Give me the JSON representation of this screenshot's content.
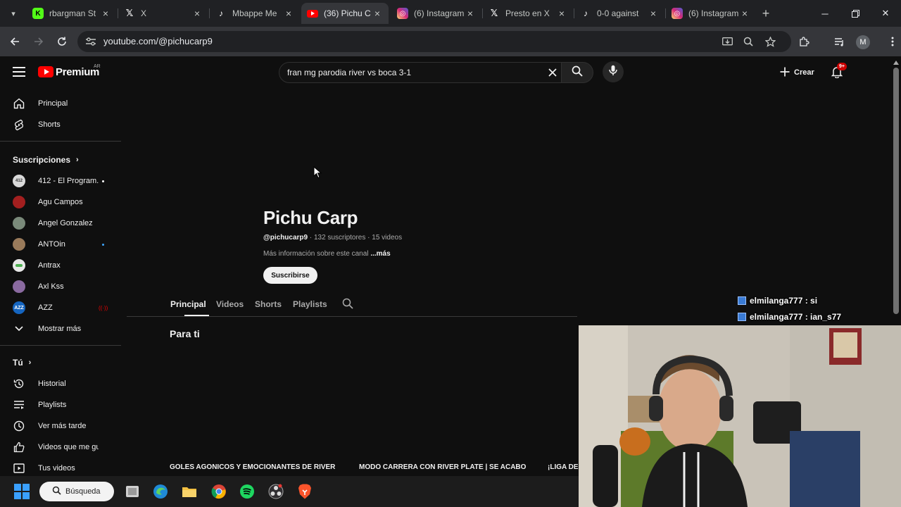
{
  "browser": {
    "tabs": [
      {
        "title": "rbargman St",
        "favicon": "kick-logo",
        "color": "#53fc18",
        "active": false
      },
      {
        "title": "X",
        "favicon": "x-logo",
        "color": "#000000",
        "active": false
      },
      {
        "title": "Mbappe Me",
        "favicon": "tiktok-logo",
        "color": "#000000",
        "active": false
      },
      {
        "title": "(36) Pichu C",
        "favicon": "youtube-logo",
        "color": "#ff0000",
        "active": true
      },
      {
        "title": "(6) Instagram",
        "favicon": "instagram-logo",
        "color": "#d62976",
        "active": false
      },
      {
        "title": "Presto en X",
        "favicon": "x-logo",
        "color": "#000000",
        "active": false
      },
      {
        "title": "0-0 against",
        "favicon": "tiktok-logo",
        "color": "#000000",
        "active": false
      },
      {
        "title": "(6) Instagram",
        "favicon": "instagram-logo",
        "color": "#d62976",
        "active": false
      }
    ],
    "url": "youtube.com/@pichucarp9",
    "profile_initial": "M"
  },
  "youtube": {
    "logo_text": "Premium",
    "country_code": "AR",
    "search_query": "fran mg parodia river vs boca 3-1",
    "create_label": "Crear",
    "notification_count": "9+"
  },
  "sidebar": {
    "main": [
      {
        "label": "Principal",
        "icon": "home-icon"
      },
      {
        "label": "Shorts",
        "icon": "shorts-icon"
      }
    ],
    "subscriptions_heading": "Suscripciones",
    "subscriptions": [
      {
        "label": "412 - El Program...",
        "avatar_color": "#d9d9d9",
        "status": "new"
      },
      {
        "label": "Agu Campos",
        "avatar_color": "#a31f1f",
        "status": ""
      },
      {
        "label": "Angel Gonzalez",
        "avatar_color": "#7a8a7a",
        "status": ""
      },
      {
        "label": "ANTOin",
        "avatar_color": "#9a7b5b",
        "status": "new"
      },
      {
        "label": "Antrax",
        "avatar_color": "#e8e8e8",
        "status": ""
      },
      {
        "label": "Axl Kss",
        "avatar_color": "#8a6aa0",
        "status": ""
      },
      {
        "label": "AZZ",
        "avatar_color": "#1565c0",
        "status": "live"
      }
    ],
    "show_more": "Mostrar más",
    "you_heading": "Tú",
    "you": [
      {
        "label": "Historial",
        "icon": "history-icon"
      },
      {
        "label": "Playlists",
        "icon": "playlists-icon"
      },
      {
        "label": "Ver más tarde",
        "icon": "watch-later-icon"
      },
      {
        "label": "Videos que me gus...",
        "icon": "like-icon"
      },
      {
        "label": "Tus videos",
        "icon": "your-videos-icon"
      }
    ]
  },
  "channel": {
    "name": "Pichu Carp",
    "handle": "@pichucarp9",
    "meta": "· 132 suscriptores · 15 videos",
    "description": "Más información sobre este canal",
    "more": "...más",
    "subscribe": "Suscribirse",
    "tabs": [
      "Principal",
      "Videos",
      "Shorts",
      "Playlists"
    ],
    "section_title": "Para ti",
    "videos": [
      "GOLES AGONICOS Y EMOCIONANTES DE RIVER",
      "MODO CARRERA CON RIVER PLATE | SE ACABO",
      "¡LIGA DE"
    ]
  },
  "overlay": {
    "chat": [
      "elmilanga777 : si",
      "elmilanga777 : ian_s77"
    ]
  },
  "taskbar": {
    "search_label": "Búsqueda"
  }
}
